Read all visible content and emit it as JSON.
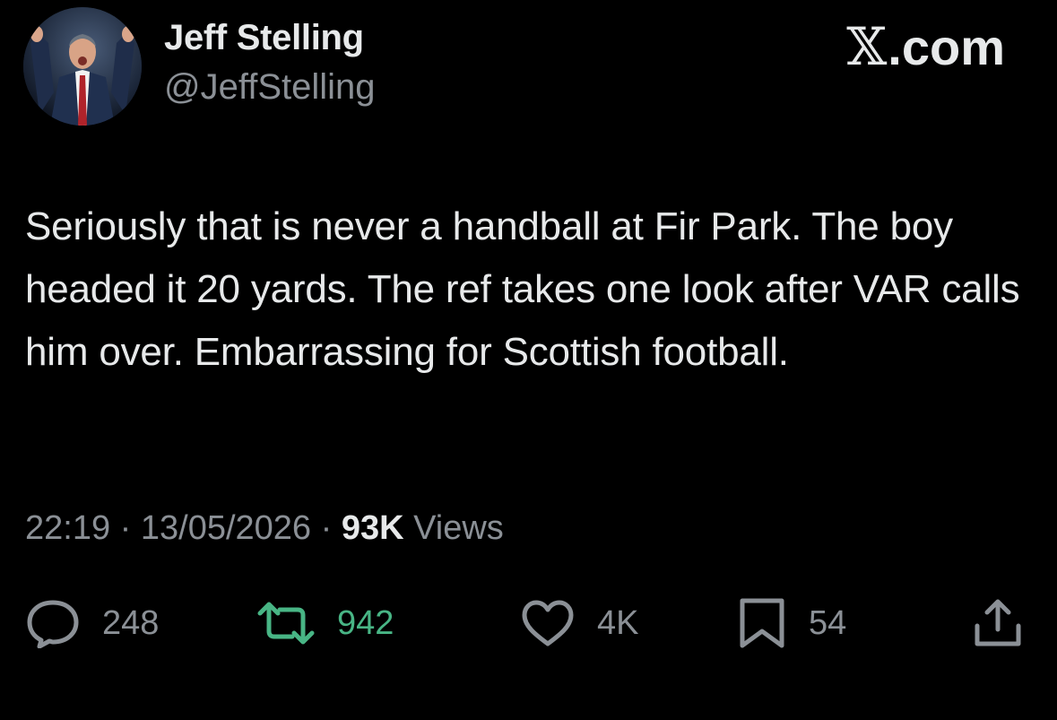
{
  "author": {
    "display_name": "Jeff Stelling",
    "handle": "@JeffStelling"
  },
  "brand": {
    "label": ".com",
    "icon": "x-logo-icon"
  },
  "tweet": {
    "text": "Seriously that is never a handball at Fir Park. The boy headed it 20 yards. The ref takes one look after VAR calls him over. Embarrassing for Scottish football."
  },
  "meta": {
    "time": "22:19",
    "separator": "·",
    "date": "13/05/2026",
    "views_count": "93K",
    "views_label": "Views"
  },
  "actions": {
    "replies": "248",
    "reposts": "942",
    "likes": "4K",
    "bookmarks": "54"
  },
  "colors": {
    "background": "#000000",
    "primary_text": "#e7e9ea",
    "secondary_text": "#8b9096",
    "repost_active": "#48b585"
  },
  "icons": [
    "reply-icon",
    "repost-icon",
    "like-icon",
    "bookmark-icon",
    "share-icon"
  ]
}
